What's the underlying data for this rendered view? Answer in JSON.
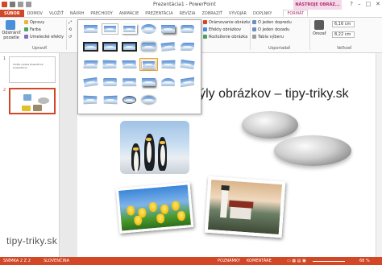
{
  "window": {
    "title": "Prezentácia1 - PowerPoint",
    "context_tools": "NÁSTROJE OBRÁZ...",
    "controls": [
      "?",
      "–",
      "□",
      "✕"
    ]
  },
  "tabs": [
    {
      "label": "SÚBOR"
    },
    {
      "label": "DOMOV"
    },
    {
      "label": "VLOŽIŤ"
    },
    {
      "label": "NÁVRH"
    },
    {
      "label": "PRECHODY"
    },
    {
      "label": "ANIMÁCIE"
    },
    {
      "label": "PREZENTÁCIA"
    },
    {
      "label": "REVÍZIA"
    },
    {
      "label": "ZOBRAZIŤ"
    },
    {
      "label": "VÝVOJÁR"
    },
    {
      "label": "DOPLNKY"
    },
    {
      "label": "FORMÁT"
    }
  ],
  "ribbon": {
    "remove_bg": "Odstrániť pozadie",
    "corrections": "Opravy",
    "color": "Farba",
    "artistic": "Umelecké efekty",
    "group_adjust": "Upraviť",
    "picture_border": "Orámovanie obrázka",
    "picture_effects": "Efekty obrázkov",
    "picture_layout": "Rozloženie obrázka",
    "bring_forward": "O jeden dopredu",
    "send_backward": "O jeden dozadu",
    "selection_pane": "Tabla výberu",
    "group_arrange": "Usporiadať",
    "crop": "Orezať",
    "height": "6,16 cm",
    "width": "8,22 cm",
    "group_size": "Veľkosť"
  },
  "slides_pane": {
    "slide1_number": "1",
    "slide1_text": "Vložte nadpis PowerPoint prezentácie",
    "slide2_number": "2"
  },
  "slide": {
    "title": "Štýly obrázkov – tipy-triky.sk",
    "watermark": "tipy-triky.sk"
  },
  "status": {
    "slide_info": "SNÍMKA 2 Z 2",
    "language": "SLOVENČINA",
    "notes": "POZNÁMKY",
    "comments": "KOMENTÁRE",
    "zoom": "68 %"
  },
  "colors": {
    "accent": "#d24726",
    "context": "#b0306a",
    "selection": "#e8a33d"
  }
}
